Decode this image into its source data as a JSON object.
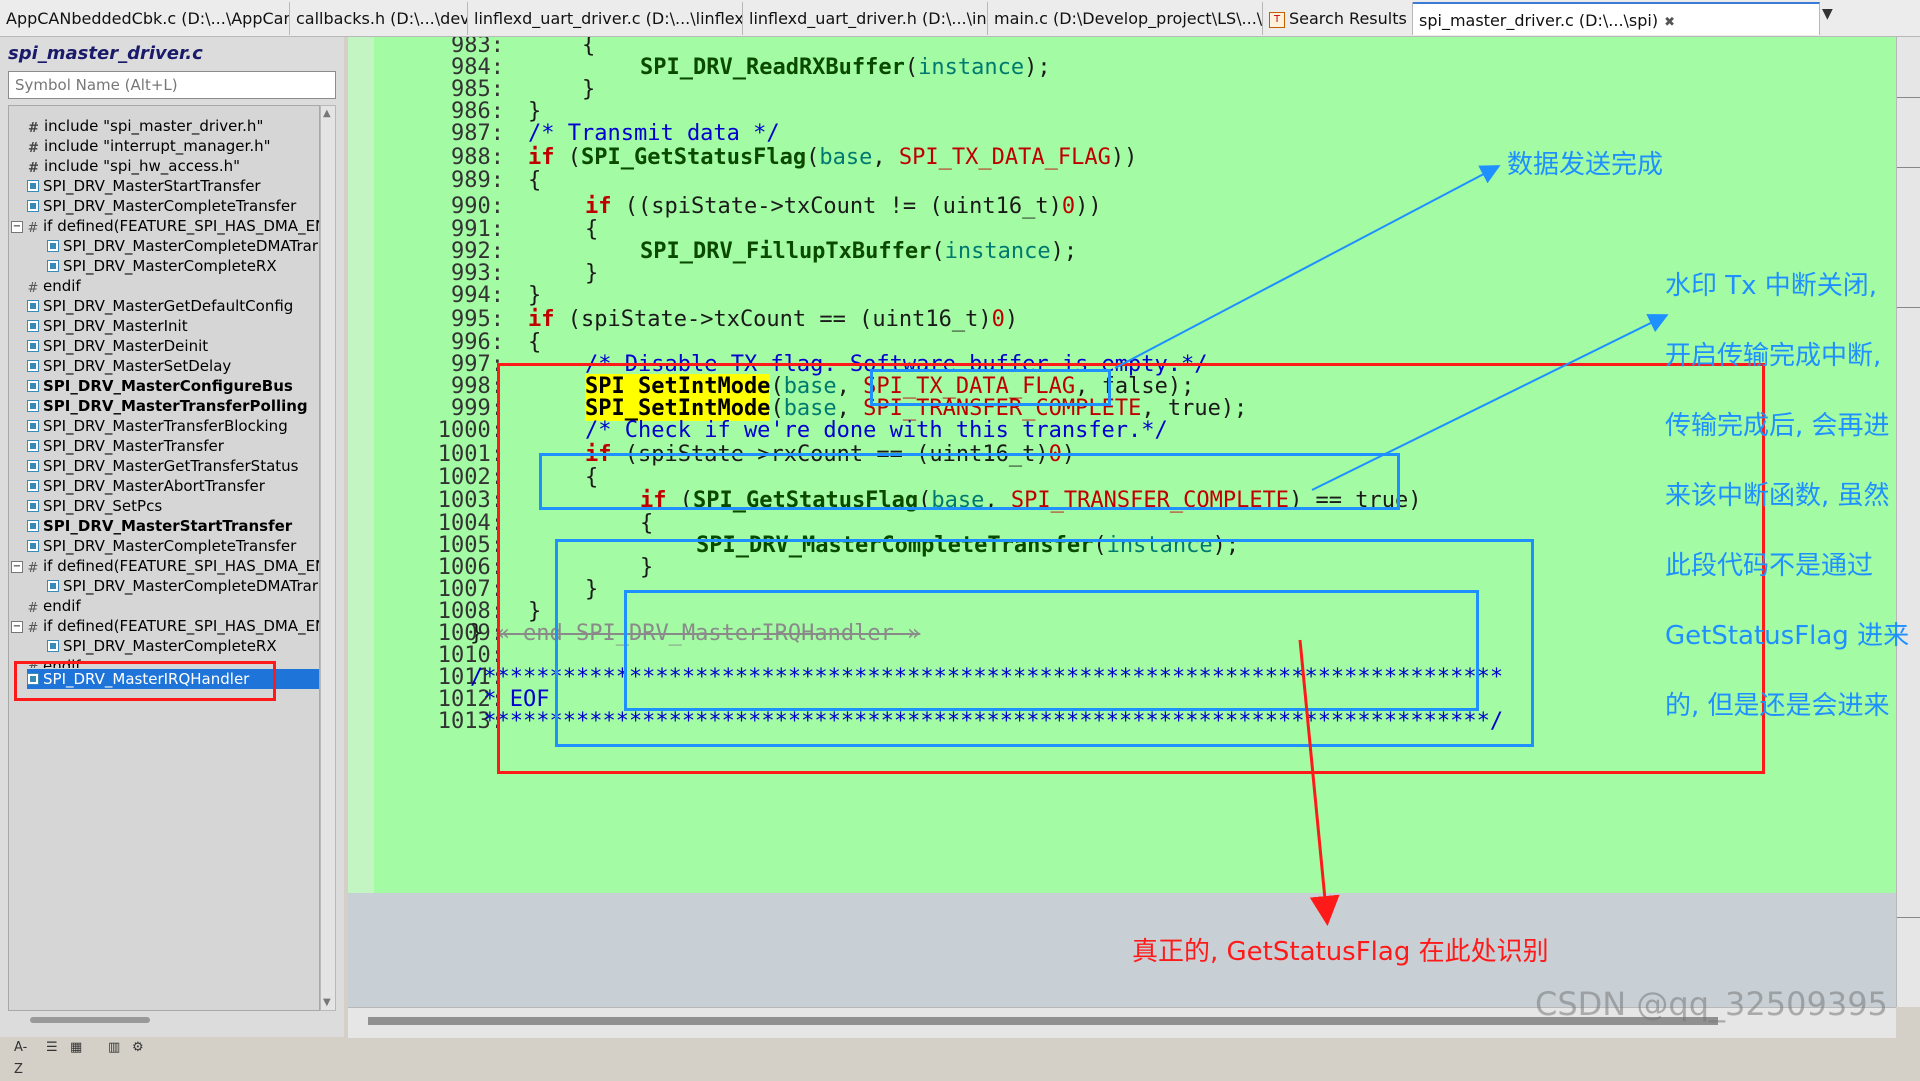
{
  "tabs": [
    {
      "label": "AppCANbeddedCbk.c (D:\\...\\AppCanbedded)"
    },
    {
      "label": "callbacks.h (D:\\...\\devices)"
    },
    {
      "label": "linflexd_uart_driver.c (D:\\...\\linflexd)"
    },
    {
      "label": "linflexd_uart_driver.h (D:\\...\\inc)"
    },
    {
      "label": "main.c (D:\\Develop_project\\LS\\...\\app)"
    },
    {
      "label": "Search Results"
    },
    {
      "label": "spi_master_driver.c (D:\\...\\spi)"
    }
  ],
  "left_panel": {
    "title": "spi_master_driver.c",
    "search_placeholder": "Symbol Name (Alt+L)",
    "symbols": [
      {
        "label": "include \"spi_master_driver.h\"",
        "icon": "include-icon"
      },
      {
        "label": "include \"interrupt_manager.h\"",
        "icon": "include-icon"
      },
      {
        "label": "include \"spi_hw_access.h\"",
        "icon": "include-icon"
      },
      {
        "label": "SPI_DRV_MasterStartTransfer",
        "icon": "function-icon"
      },
      {
        "label": "SPI_DRV_MasterCompleteTransfer",
        "icon": "function-icon"
      },
      {
        "label": "if defined(FEATURE_SPI_HAS_DMA_EN",
        "icon": "preprocessor-icon"
      },
      {
        "label": "SPI_DRV_MasterCompleteDMATrar",
        "icon": "function-icon"
      },
      {
        "label": "SPI_DRV_MasterCompleteRX",
        "icon": "function-icon"
      },
      {
        "label": "endif",
        "icon": "preprocessor-icon"
      },
      {
        "label": "SPI_DRV_MasterGetDefaultConfig",
        "icon": "function-icon"
      },
      {
        "label": "SPI_DRV_MasterInit",
        "icon": "function-icon"
      },
      {
        "label": "SPI_DRV_MasterDeinit",
        "icon": "function-icon"
      },
      {
        "label": "SPI_DRV_MasterSetDelay",
        "icon": "function-icon"
      },
      {
        "label": "SPI_DRV_MasterConfigureBus",
        "icon": "function-icon"
      },
      {
        "label": "SPI_DRV_MasterTransferPolling",
        "icon": "function-icon"
      },
      {
        "label": "SPI_DRV_MasterTransferBlocking",
        "icon": "function-icon"
      },
      {
        "label": "SPI_DRV_MasterTransfer",
        "icon": "function-icon"
      },
      {
        "label": "SPI_DRV_MasterGetTransferStatus",
        "icon": "function-icon"
      },
      {
        "label": "SPI_DRV_MasterAbortTransfer",
        "icon": "function-icon"
      },
      {
        "label": "SPI_DRV_SetPcs",
        "icon": "function-icon"
      },
      {
        "label": "SPI_DRV_MasterStartTransfer",
        "icon": "function-icon"
      },
      {
        "label": "SPI_DRV_MasterCompleteTransfer",
        "icon": "function-icon"
      },
      {
        "label": "if defined(FEATURE_SPI_HAS_DMA_EN",
        "icon": "preprocessor-icon"
      },
      {
        "label": "SPI_DRV_MasterCompleteDMATrar",
        "icon": "function-icon"
      },
      {
        "label": "endif",
        "icon": "preprocessor-icon"
      },
      {
        "label": "if defined(FEATURE_SPI_HAS_DMA_EN",
        "icon": "preprocessor-icon"
      },
      {
        "label": "SPI_DRV_MasterCompleteRX",
        "icon": "function-icon"
      },
      {
        "label": "endif",
        "icon": "preprocessor-icon"
      },
      {
        "label": "SPI_DRV_MasterIRQHandler",
        "icon": "function-icon"
      }
    ],
    "toolbar": {
      "sort_label": "A-Z"
    }
  },
  "editor": {
    "lines": [
      {
        "n": "983:"
      },
      {
        "n": "984:"
      },
      {
        "n": "985:"
      },
      {
        "n": "986:"
      },
      {
        "n": "987:"
      },
      {
        "n": "988:"
      },
      {
        "n": "989:"
      },
      {
        "n": "990:"
      },
      {
        "n": "991:"
      },
      {
        "n": "992:"
      },
      {
        "n": "993:"
      },
      {
        "n": "994:"
      },
      {
        "n": "995:"
      },
      {
        "n": "996:"
      },
      {
        "n": "997:"
      },
      {
        "n": "998:"
      },
      {
        "n": "999:"
      },
      {
        "n": "1000:"
      },
      {
        "n": "1001:"
      },
      {
        "n": "1002:"
      },
      {
        "n": "1003:"
      },
      {
        "n": "1004:"
      },
      {
        "n": "1005:"
      },
      {
        "n": "1006:"
      },
      {
        "n": "1007:"
      },
      {
        "n": "1008:"
      },
      {
        "n": "1009:"
      },
      {
        "n": "1010:"
      },
      {
        "n": "1011:"
      },
      {
        "n": "1012:"
      },
      {
        "n": "1013:"
      }
    ],
    "code": {
      "l983": "{",
      "l984_fn": "SPI_DRV_ReadRXBuffer",
      "l984_p": "instance",
      "l985": "}",
      "l986": "}",
      "l987": "/* Transmit data */",
      "l988_fn": "SPI_GetStatusFlag",
      "l988_base": "base",
      "l988_mac": "SPI_TX_DATA_FLAG",
      "l989": "{",
      "l990_expr": "spiState->txCount != (uint16_t)",
      "l990_num": "0",
      "l991": "{",
      "l992_fn": "SPI_DRV_FillupTxBuffer",
      "l992_p": "instance",
      "l993": "}",
      "l994": "}",
      "l995_expr": "spiState->txCount == (uint16_t)",
      "l995_num": "0",
      "l996": "{",
      "l997": "/* Disable TX flag. Software buffer is empty.*/",
      "l998_fn": "SPI_SetIntMode",
      "l998_base": "base",
      "l998_mac": "SPI_TX_DATA_FLAG",
      "l998_val": "false",
      "l999_fn": "SPI_SetIntMode",
      "l999_base": "base",
      "l999_mac": "SPI_TRANSFER_COMPLETE",
      "l999_val": "true",
      "l1000": "/* Check if we're done with this transfer.*/",
      "l1001_expr": "spiState->rxCount == (uint16_t)",
      "l1001_num": "0",
      "l1002": "{",
      "l1003_fn": "SPI_GetStatusFlag",
      "l1003_base": "base",
      "l1003_mac": "SPI_TRANSFER_COMPLETE",
      "l1003_val": "true",
      "l1004": "{",
      "l1005_fn": "SPI_DRV_MasterCompleteTransfer",
      "l1005_p": "instance",
      "l1006": "}",
      "l1007": "}",
      "l1008": "}",
      "l1009": "}",
      "l1009_end": "« end SPI_DRV_MasterIRQHandler »",
      "l1011": "/*****************************************************************************",
      "l1012": " * EOF",
      "l1013": " ****************************************************************************/",
      "kw_if": "if"
    }
  },
  "annotations": {
    "note_tx_done": "数据发送完成",
    "note_side": [
      "水印 Tx 中断关闭,",
      "开启传输完成中断,",
      "传输完成后, 会再进",
      "来该中断函数, 虽然",
      "此段代码不是通过",
      "GetStatusFlag 进来",
      "的, 但是还是会进来"
    ],
    "note_real": "真正的, GetStatusFlag 在此处识别",
    "colors": {
      "red": "#ff1a1a",
      "blue": "#1e90ff"
    }
  },
  "watermark": "CSDN @qq_32509395"
}
